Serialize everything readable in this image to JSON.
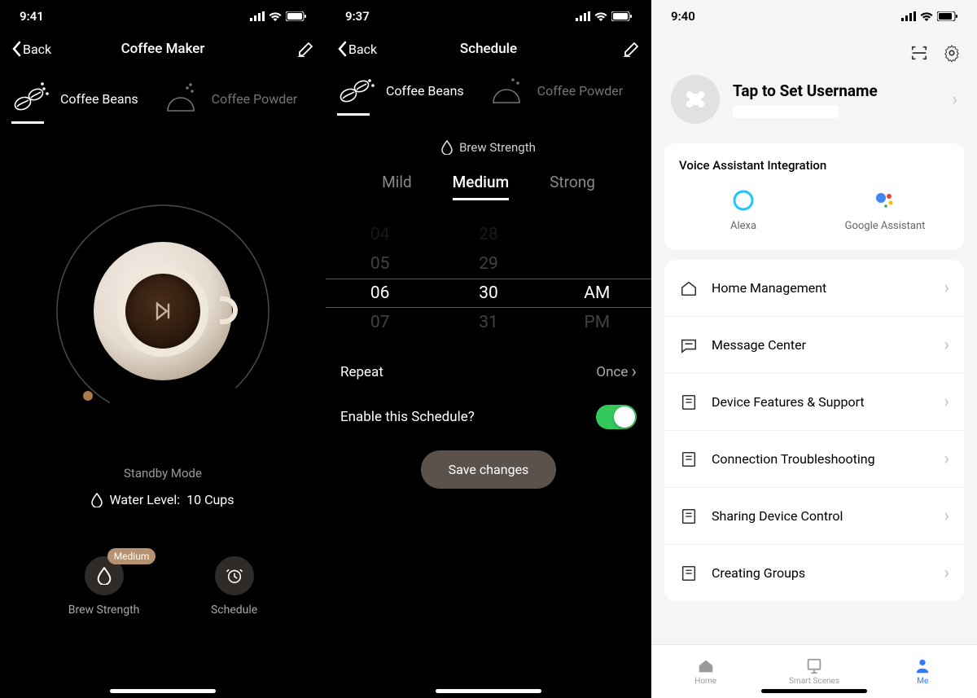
{
  "s1": {
    "time": "9:41",
    "back": "Back",
    "title": "Coffee Maker",
    "tabs": {
      "beans": "Coffee Beans",
      "powder": "Coffee Powder"
    },
    "standby": "Standby Mode",
    "water_label": "Water Level:",
    "water_value": "10 Cups",
    "strength_label": "Brew Strength",
    "strength_badge": "Medium",
    "schedule_label": "Schedule"
  },
  "s2": {
    "time": "9:37",
    "back": "Back",
    "title": "Schedule",
    "tabs": {
      "beans": "Coffee Beans",
      "powder": "Coffee Powder"
    },
    "brew_strength": "Brew Strength",
    "strengths": {
      "mild": "Mild",
      "medium": "Medium",
      "strong": "Strong"
    },
    "picker": {
      "h_prev2": "04",
      "h_prev": "05",
      "h_sel": "06",
      "h_next": "07",
      "m_prev2": "28",
      "m_prev": "29",
      "m_sel": "30",
      "m_next": "31",
      "ap_sel": "AM",
      "ap_next": "PM"
    },
    "repeat_label": "Repeat",
    "repeat_value": "Once",
    "enable_label": "Enable this Schedule?",
    "save": "Save changes"
  },
  "s3": {
    "time": "9:40",
    "username": "Tap to Set Username",
    "voice_title": "Voice Assistant Integration",
    "alexa": "Alexa",
    "google": "Google Assistant",
    "menu": {
      "home": "Home Management",
      "msg": "Message Center",
      "faq": "Device Features & Support",
      "net": "Connection Troubleshooting",
      "share": "Sharing Device Control",
      "group": "Creating Groups"
    },
    "tabs": {
      "home": "Home",
      "smart": "Smart Scenes",
      "me": "Me"
    }
  }
}
